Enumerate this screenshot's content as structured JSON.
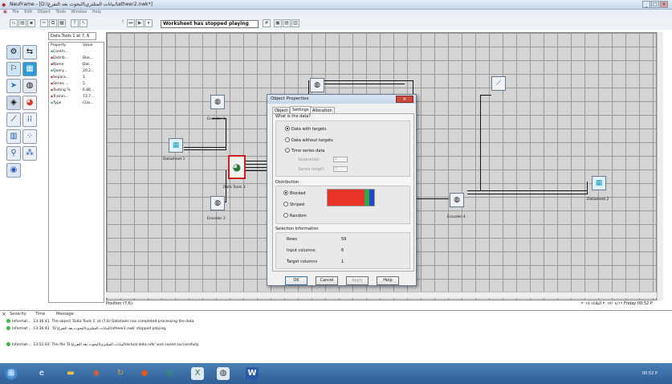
{
  "window": {
    "title": "NeuFrame - [D:\\ابيانات المتلثري\\البحوث بعد التفرغ\\atheer2.nwk*]"
  },
  "menu": [
    "File",
    "Edit",
    "Object",
    "Tools",
    "Window",
    "Help"
  ],
  "toolbar": {
    "status": "Worksheet has stopped playing"
  },
  "props": {
    "tab": "Data Tools 1 at 7, 6",
    "header_property": "Property",
    "header_value": "Value",
    "rows": [
      {
        "p": "Comm...",
        "v": ""
      },
      {
        "p": "Distrib...",
        "v": "Bloc..."
      },
      {
        "p": "Name",
        "v": "Dat..."
      },
      {
        "p": "Query...",
        "v": "20.2..."
      },
      {
        "p": "Separa...",
        "v": "1"
      },
      {
        "p": "Series ...",
        "v": "5"
      },
      {
        "p": "Testing %",
        "v": "6.86..."
      },
      {
        "p": "Trainin...",
        "v": "73.7..."
      },
      {
        "p": "Type",
        "v": "Clas..."
      }
    ]
  },
  "nodes": {
    "datasheet1": "Datasheet 1",
    "encoder1": "Encoder 1",
    "encoder2": "Encoder 2",
    "datatools1": "Data Tools 1",
    "encoder4": "Encoder 4",
    "datasheet2": "Datasheet 2"
  },
  "dialog": {
    "title": "Object Properties",
    "tabs": [
      "Object",
      "Settings",
      "Allocation"
    ],
    "what_label": "What is the data?",
    "opt_targets": "Data with targets",
    "opt_no_targets": "Data without targets",
    "opt_series": "Time series data",
    "separation_label": "Separation",
    "separation_value": "1",
    "series_label": "Series length",
    "series_value": "5",
    "distribution_label": "Distribution",
    "dist_blocked": "Blocked",
    "dist_striped": "Striped",
    "dist_random": "Random",
    "sel_label": "Selection Information",
    "rows_label": "Rows",
    "rows_value": "59",
    "input_label": "Input columns",
    "input_value": "6",
    "target_label": "Target columns",
    "target_value": "1",
    "ok": "OK",
    "cancel": "Cancel",
    "apply": "Apply",
    "help": "Help",
    "colors": {
      "red": "#e8332a",
      "green": "#2fa845",
      "blue": "#2747c9"
    }
  },
  "position": "Position (7,6)",
  "clock_status": "٢٠١٧/٠٤/١٦ الثلاثاء ٢٠١٥ Friday 00:52 P",
  "log": {
    "headers": [
      "Severity",
      "Time",
      "Message"
    ],
    "rows": [
      {
        "sev": "Informat...",
        "time": "13:36:41",
        "msg": "The object 'Data Tools 1' at (7,6) Datatools has completed processing the data"
      },
      {
        "sev": "Informat...",
        "time": "13:36:42",
        "msg": "'D:\\البيانات المتلثري\\البحوث بعد التفرغ\\atheer2.nwk' stopped playing."
      },
      {
        "sev": "Informat...",
        "time": "13:51:03",
        "msg": "The file 'D:\\البيانات المتلثري\\البحوث بعد التفرغ\\actual data.ndx' was saved successfully."
      }
    ]
  },
  "tray_time": "00:52 P"
}
